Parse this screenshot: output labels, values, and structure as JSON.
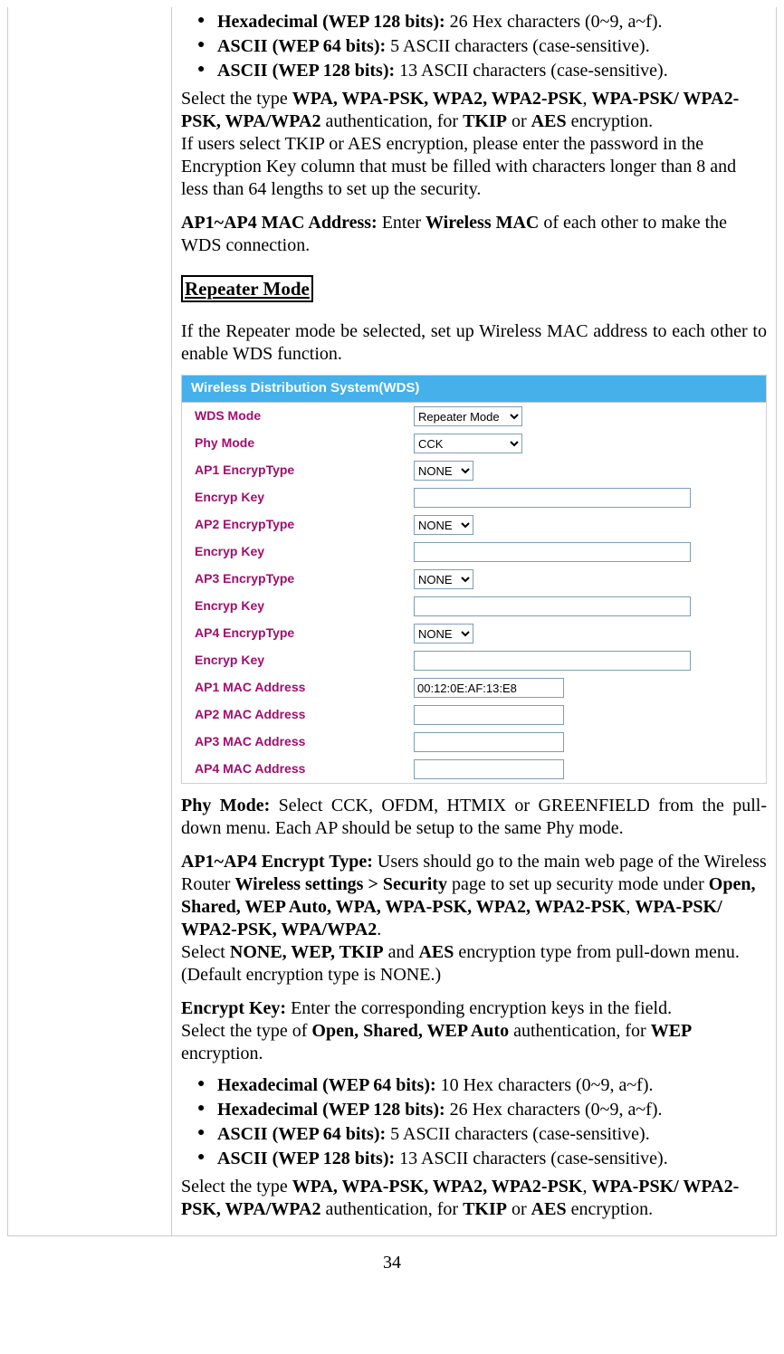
{
  "top_bullets": [
    {
      "strong": "Hexadecimal (WEP 128 bits):",
      "rest": " 26 Hex characters (0~9, a~f)."
    },
    {
      "strong": "ASCII (WEP 64 bits):",
      "rest": " 5 ASCII characters (case-sensitive)."
    },
    {
      "strong": "ASCII (WEP 128 bits):",
      "rest": " 13 ASCII characters (case-sensitive)."
    }
  ],
  "para1": {
    "pre": "Select the type ",
    "b1": "WPA, WPA-PSK, WPA2, WPA2-PSK",
    "mid1": ", ",
    "b2": "WPA-PSK/ WPA2-PSK, WPA/WPA2",
    "mid2": " authentication, for  ",
    "b3": "TKIP",
    "mid3": " or ",
    "b4": "AES",
    "mid4": " encryption.",
    "line2": "If users select TKIP or AES encryption, please enter the password in the Encryption Key column that must be filled with characters longer than 8 and less than 64 lengths to set up the security."
  },
  "para2": {
    "b1": "AP1~AP4 MAC Address:",
    "mid1": " Enter ",
    "b2": "Wireless MAC",
    "mid2": " of each other to make the WDS connection."
  },
  "repeater_heading": "Repeater Mode",
  "para3": "If the Repeater mode be selected, set up Wireless MAC address to each other to enable WDS function.",
  "wds": {
    "title": "Wireless Distribution System(WDS)",
    "rows": {
      "mode_label": "WDS Mode",
      "mode_value": "Repeater Mode",
      "phy_label": "Phy Mode",
      "phy_value": "CCK",
      "enc_label_1": "AP1 EncrypType",
      "enc_label_2": "AP2 EncrypType",
      "enc_label_3": "AP3 EncrypType",
      "enc_label_4": "AP4 EncrypType",
      "enc_value": "NONE",
      "key_label": "Encryp Key",
      "mac_label_1": "AP1 MAC Address",
      "mac_label_2": "AP2 MAC Address",
      "mac_label_3": "AP3 MAC Address",
      "mac_label_4": "AP4 MAC Address",
      "mac1_value": "00:12:0E:AF:13:E8",
      "mac_empty": ""
    }
  },
  "para4": {
    "b1": "Phy Mode:",
    "rest": " Select CCK, OFDM, HTMIX or GREENFIELD from the pull-down menu. Each AP should be setup to the same Phy mode."
  },
  "para5": {
    "b1": "AP1~AP4 Encrypt Type:",
    "t1": " Users should go to the main web page of the Wireless  Router ",
    "b2": "Wireless settings > Security",
    "t2": " page to set up security mode under ",
    "b3": "Open, Shared, WEP Auto, WPA, WPA-PSK, WPA2, WPA2-PSK",
    "t3": ", ",
    "b4": "WPA-PSK/ WPA2-PSK, WPA/WPA2",
    "t4": ".",
    "line2pre": "Select ",
    "line2b1": "NONE, WEP, TKIP",
    "line2mid": " and ",
    "line2b2": "AES",
    "line2post": "  encryption type from pull-down menu. (Default encryption type is NONE.)"
  },
  "para6": {
    "b1": "Encrypt Key:",
    "t1": " Enter the corresponding encryption keys in the field.",
    "line2pre": "Select the type of ",
    "line2b": "Open, Shared, WEP Auto",
    "line2mid": " authentication, for ",
    "line2b2": "WEP",
    "line2post": " encryption."
  },
  "bottom_bullets": [
    {
      "strong": "Hexadecimal (WEP 64 bits):",
      "rest": " 10 Hex characters (0~9, a~f)."
    },
    {
      "strong": "Hexadecimal (WEP 128 bits):",
      "rest": " 26 Hex characters (0~9, a~f)."
    },
    {
      "strong": "ASCII (WEP 64 bits):",
      "rest": " 5 ASCII characters (case-sensitive)."
    },
    {
      "strong": "ASCII (WEP 128 bits):",
      "rest": " 13 ASCII characters (case-sensitive)."
    }
  ],
  "para7": {
    "pre": "Select the type ",
    "b1": "WPA, WPA-PSK, WPA2, WPA2-PSK",
    "mid1": ", ",
    "b2": "WPA-PSK/ WPA2-PSK, WPA/WPA2",
    "mid2": " authentication, for  ",
    "b3": "TKIP",
    "mid3": " or ",
    "b4": "AES",
    "mid4": " encryption."
  },
  "page_number": "34"
}
